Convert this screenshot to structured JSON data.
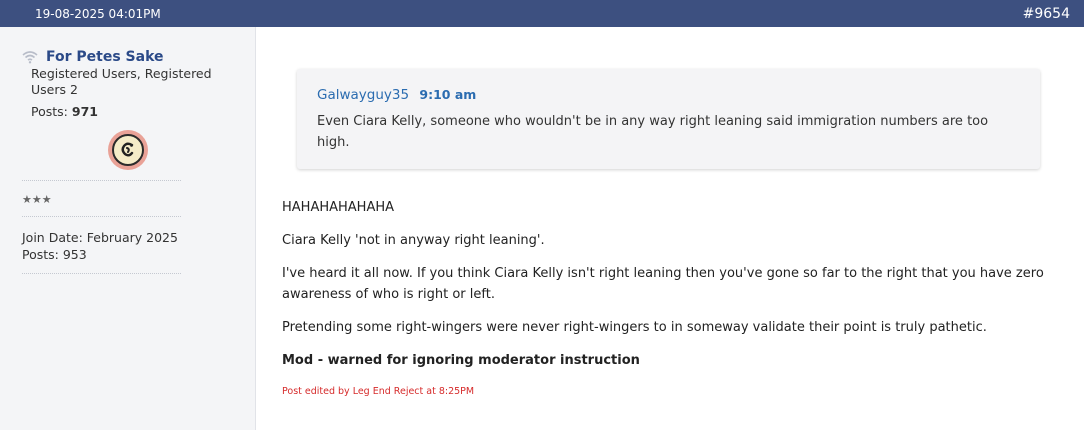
{
  "header": {
    "date": "19-08-2025 04:01PM",
    "post_number": "#9654"
  },
  "user": {
    "name": "For Petes Sake",
    "groups": "Registered Users, Registered Users 2",
    "posts_label": "Posts:",
    "posts_count": "971",
    "stars": "★★★",
    "join_date": "Join Date: February 2025",
    "posts_line": "Posts: 953"
  },
  "quote": {
    "author": "Galwayguy35",
    "time": "9:10 am",
    "text": "Even Ciara Kelly, someone who wouldn't be in any way right leaning said immigration numbers are too high."
  },
  "post": {
    "paragraphs": [
      "HAHAHAHAHAHA",
      "Ciara Kelly 'not in anyway right leaning'.",
      "I've heard it all now. If you think Ciara Kelly isn't right leaning then you've gone so far to the right that you have zero awareness of who is right or left.",
      "Pretending some right-wingers were never right-wingers to in someway validate their point is truly pathetic."
    ],
    "mod_note": "Mod - warned for ignoring moderator instruction",
    "edited_note": "Post edited by Leg End Reject at 8:25PM"
  },
  "colors": {
    "header_bg": "#3d5080",
    "username": "#2b4a88",
    "link": "#2b6cb0",
    "edited": "#d62b2b"
  },
  "icons": {
    "status": "wifi-icon",
    "avatar": "avatar-image"
  }
}
